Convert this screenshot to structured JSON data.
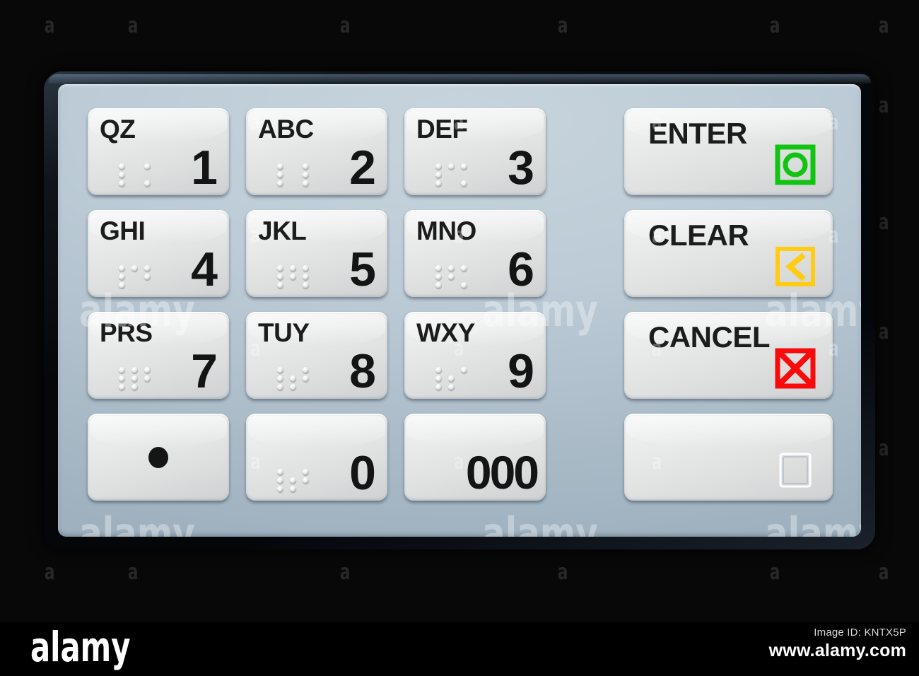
{
  "device": {
    "name": "ATM PIN pad / encrypting keypad",
    "bezel_color": "#05070a",
    "panel_color": "#b6c6d2",
    "key_face_color": "#e4e6e6",
    "key_text_color": "#141414"
  },
  "keypad": {
    "numeric_keys": [
      {
        "letters": "QZ",
        "digit": "1",
        "braille": [
          [
            1,
            0,
            1
          ],
          [
            1,
            0,
            0
          ],
          [
            1,
            0,
            1
          ]
        ],
        "has_braille": true
      },
      {
        "letters": "ABC",
        "digit": "2",
        "braille": [
          [
            1,
            0,
            1
          ],
          [
            1,
            0,
            1
          ],
          [
            1,
            0,
            1
          ]
        ],
        "has_braille": true
      },
      {
        "letters": "DEF",
        "digit": "3",
        "braille": [
          [
            1,
            1,
            1
          ],
          [
            1,
            0,
            0
          ],
          [
            1,
            0,
            1
          ]
        ],
        "has_braille": true
      },
      {
        "letters": "GHI",
        "digit": "4",
        "braille": [
          [
            1,
            1,
            1
          ],
          [
            1,
            0,
            1
          ],
          [
            1,
            0,
            0
          ]
        ],
        "has_braille": true
      },
      {
        "letters": "JKL",
        "digit": "5",
        "braille": [
          [
            1,
            1,
            1
          ],
          [
            1,
            1,
            1
          ],
          [
            1,
            0,
            1
          ]
        ],
        "has_braille": true
      },
      {
        "letters": "MNO",
        "digit": "6",
        "braille": [
          [
            1,
            1,
            1
          ],
          [
            1,
            1,
            0
          ],
          [
            1,
            0,
            1
          ]
        ],
        "has_braille": true
      },
      {
        "letters": "PRS",
        "digit": "7",
        "braille": [
          [
            1,
            1,
            1
          ],
          [
            1,
            1,
            1
          ],
          [
            1,
            1,
            0
          ]
        ],
        "has_braille": true
      },
      {
        "letters": "TUY",
        "digit": "8",
        "braille": [
          [
            1,
            0,
            1
          ],
          [
            1,
            1,
            1
          ],
          [
            1,
            1,
            0
          ]
        ],
        "has_braille": true
      },
      {
        "letters": "WXY",
        "digit": "9",
        "braille": [
          [
            1,
            0,
            1
          ],
          [
            1,
            1,
            0
          ],
          [
            1,
            1,
            0
          ]
        ],
        "has_braille": true
      },
      {
        "letters": "",
        "digit": "",
        "braille": [],
        "has_braille": false,
        "icon": "center-dot"
      },
      {
        "letters": "",
        "digit": "0",
        "braille": [
          [
            1,
            0,
            1
          ],
          [
            1,
            1,
            1
          ],
          [
            1,
            1,
            0
          ]
        ],
        "has_braille": true
      },
      {
        "letters": "",
        "digit": "000",
        "braille": [],
        "has_braille": false
      }
    ],
    "function_keys": [
      {
        "label": "ENTER",
        "icon": "enter-circle-icon",
        "icon_color": "#12c412"
      },
      {
        "label": "CLEAR",
        "icon": "back-chevron-icon",
        "icon_color": "#ffcc11"
      },
      {
        "label": "CANCEL",
        "icon": "cross-box-icon",
        "icon_color": "#fa0a0a"
      },
      {
        "label": "",
        "icon": "blank-square-icon",
        "icon_color": "#e9ebeb"
      }
    ]
  },
  "watermark": {
    "logo_text": "alamy",
    "tile_text": "a",
    "footer_logo": "alamy",
    "image_id": "Image ID: KNTX5P",
    "url": "www.alamy.com"
  }
}
